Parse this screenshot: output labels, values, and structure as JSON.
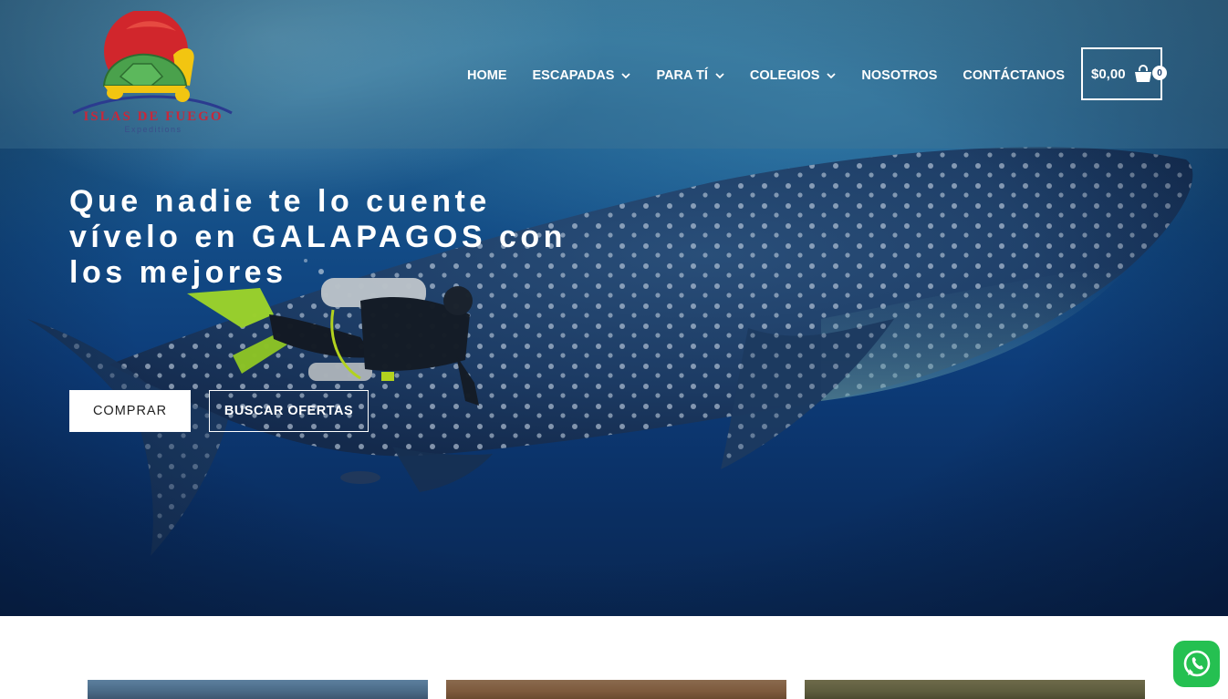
{
  "brand": {
    "name": "ISLAS DE FUEGO",
    "tagline": "Expeditions"
  },
  "nav": {
    "items": [
      {
        "label": "HOME",
        "dropdown": false
      },
      {
        "label": "ESCAPADAS",
        "dropdown": true
      },
      {
        "label": "PARA TÍ",
        "dropdown": true
      },
      {
        "label": "COLEGIOS",
        "dropdown": true
      },
      {
        "label": "NOSOTROS",
        "dropdown": false
      },
      {
        "label": "CONTÁCTANOS",
        "dropdown": false
      }
    ]
  },
  "cart": {
    "total": "$0,00",
    "count": "0",
    "icon": "shopping-bag-icon"
  },
  "hero": {
    "headline_lines": [
      "Que nadie te lo cuente",
      "vívelo en GALAPAGOS con",
      "los mejores"
    ],
    "primary_button": "COMPRAR",
    "secondary_button": "BUSCAR OFERTAS"
  },
  "floating": {
    "whatsapp_icon": "whatsapp-icon"
  },
  "colors": {
    "whatsapp": "#25c051",
    "logo_red": "#c8283a"
  }
}
